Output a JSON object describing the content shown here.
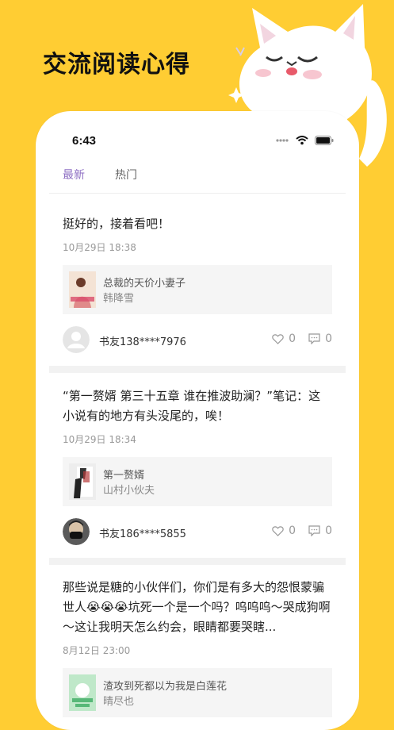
{
  "promo": {
    "title": "交流阅读心得"
  },
  "status_bar": {
    "time": "6:43"
  },
  "tabs": [
    {
      "label": "最新",
      "active": true
    },
    {
      "label": "热门",
      "active": false
    }
  ],
  "posts": [
    {
      "text": "挺好的，接着看吧！",
      "date": "10月29日 18:38",
      "book": {
        "title": "总裁的天价小妻子",
        "author": "韩降雪"
      },
      "user": "书友138****7976",
      "likes": "0",
      "comments": "0"
    },
    {
      "text": "“第一赘婿 第三十五章 谁在推波助澜？”笔记：这小说有的地方有头没尾的，唉！",
      "date": "10月29日 18:34",
      "book": {
        "title": "第一赘婿",
        "author": "山村小伙夫"
      },
      "user": "书友186****5855",
      "likes": "0",
      "comments": "0"
    },
    {
      "text": "那些说是糖的小伙伴们，你们是有多大的怨恨蒙骗世人😭😭😭坑死一个是一个吗？呜呜呜～哭成狗啊～这让我明天怎么约会，眼睛都要哭瞎...",
      "date": "8月12日 23:00",
      "book": {
        "title": "渣攻到死都以为我是白莲花",
        "author": "晴尽也"
      }
    }
  ],
  "colors": {
    "background": "#FFCD33",
    "accent": "#8E6FC3"
  }
}
